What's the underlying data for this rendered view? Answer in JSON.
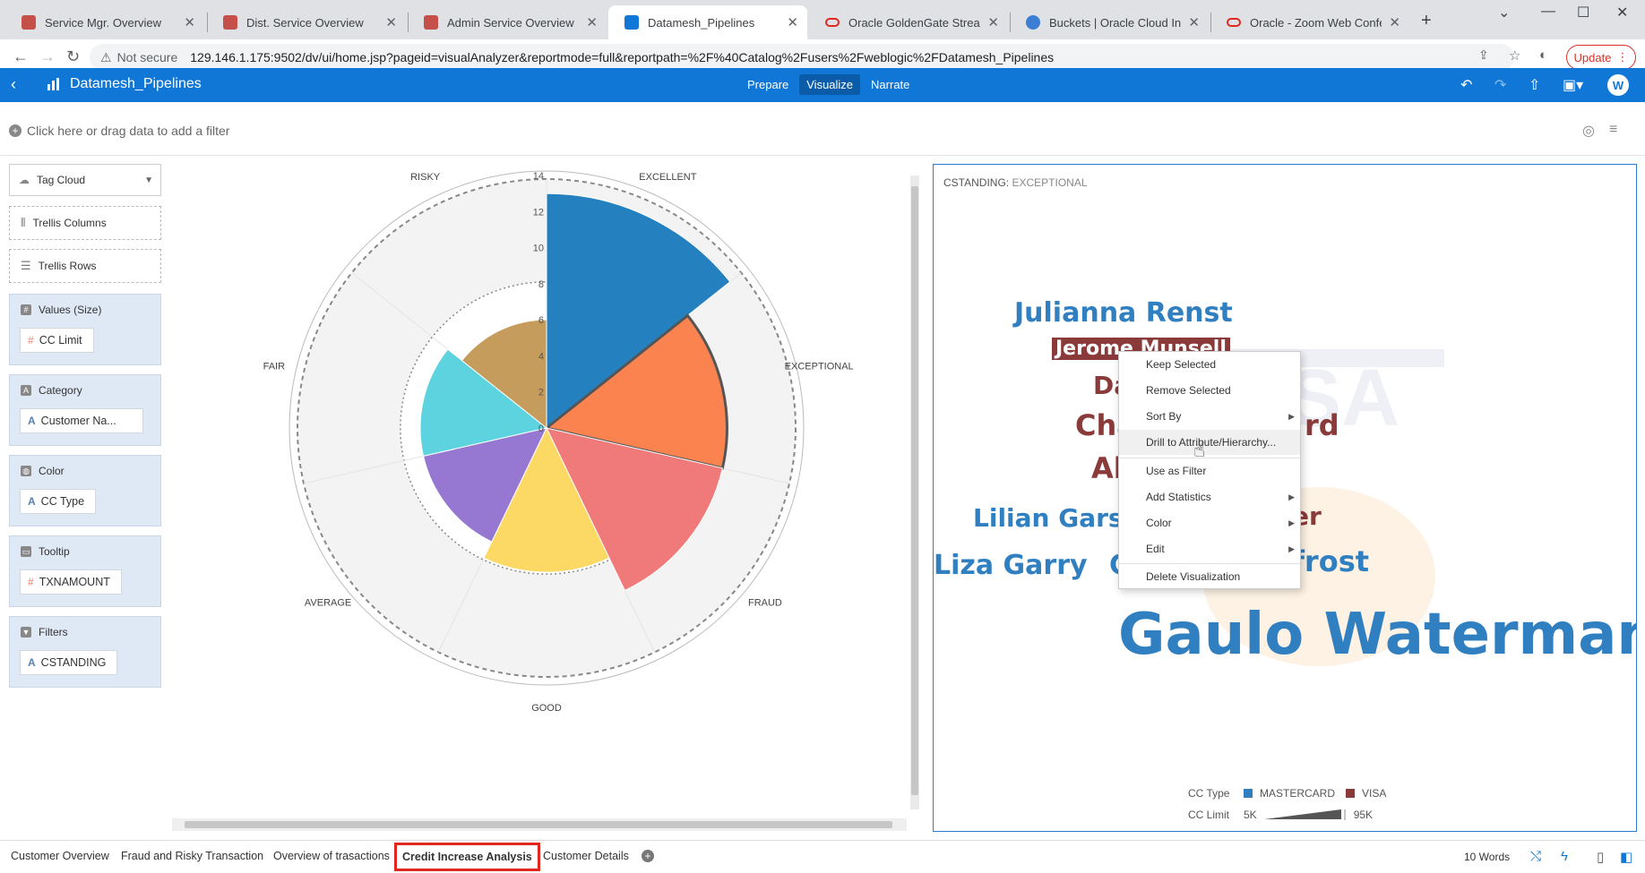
{
  "browser": {
    "tabs": [
      {
        "title": "Service Mgr. Overview",
        "color": "#c5504a"
      },
      {
        "title": "Dist. Service Overview",
        "color": "#c5504a"
      },
      {
        "title": "Admin Service Overview",
        "color": "#c5504a"
      },
      {
        "title": "Datamesh_Pipelines",
        "color": "#1177d6"
      },
      {
        "title": "Oracle GoldenGate Stream Ana",
        "color": "#e0281e"
      },
      {
        "title": "Buckets | Oracle Cloud Infrastru",
        "color": "#3b7ed4"
      },
      {
        "title": "Oracle - Zoom Web Conferenc",
        "color": "#e0281e"
      }
    ],
    "security": "Not secure",
    "url": "129.146.1.175:9502/dv/ui/home.jsp?pageid=visualAnalyzer&reportmode=full&reportpath=%2F%40Catalog%2Fusers%2Fweblogic%2FDatamesh_Pipelines",
    "update_label": "Update"
  },
  "app": {
    "project": "Datamesh_Pipelines",
    "modes": [
      "Prepare",
      "Visualize",
      "Narrate"
    ],
    "active_mode": "Visualize",
    "user_initial": "W"
  },
  "filterbar": {
    "placeholder": "Click here or drag data to add a filter"
  },
  "grammar": {
    "viz_type": "Tag Cloud",
    "trellis_columns": "Trellis Columns",
    "trellis_rows": "Trellis Rows",
    "sections": [
      {
        "header": "Values (Size)",
        "pill": "CC Limit",
        "pill_kind": "hash"
      },
      {
        "header": "Category",
        "pill": "Customer Na...",
        "pill_kind": "alpha"
      },
      {
        "header": "Color",
        "pill": "CC Type",
        "pill_kind": "alpha"
      },
      {
        "header": "Tooltip",
        "pill": "TXNAMOUNT",
        "pill_kind": "hash"
      },
      {
        "header": "Filters",
        "pill": "CSTANDING",
        "pill_kind": "alpha"
      }
    ]
  },
  "chart_data": {
    "type": "polar-area",
    "categories": [
      "EXCELLENT",
      "EXCEPTIONAL",
      "FRAUD",
      "GOOD",
      "AVERAGE",
      "FAIR",
      "RISKY"
    ],
    "values": [
      13,
      10,
      10,
      8,
      7,
      7,
      6
    ],
    "colors": [
      "#2580c0",
      "#fb8350",
      "#f07a7a",
      "#fcd964",
      "#9678d2",
      "#5ed3e0",
      "#c69c5c"
    ],
    "selected": "EXCEPTIONAL",
    "radial_ticks": [
      0,
      2,
      4,
      6,
      8,
      10,
      12,
      14
    ],
    "rmax": 14
  },
  "cloud": {
    "title_key": "CSTANDING:",
    "title_value": "EXCEPTIONAL",
    "words": [
      {
        "text": "Julianna Renst",
        "type": "mc"
      },
      {
        "text": "Jerome Munsell",
        "type": "visa",
        "selected": true
      },
      {
        "text": "Da",
        "type": "visa"
      },
      {
        "text": "Cha",
        "type": "visa"
      },
      {
        "text": "rd",
        "type": "visa"
      },
      {
        "text": "Al",
        "type": "visa"
      },
      {
        "text": "Lilian Gars",
        "type": "mc"
      },
      {
        "text": "er",
        "type": "visa"
      },
      {
        "text": "Liza Garry",
        "type": "mc"
      },
      {
        "text": "C",
        "type": "mc"
      },
      {
        "text": "frost",
        "type": "mc"
      },
      {
        "text": "Gaulo Waterman",
        "type": "mc"
      }
    ],
    "legend": {
      "color_label": "CC Type",
      "color_items": [
        {
          "label": "MASTERCARD",
          "color": "#2f7fc1"
        },
        {
          "label": "VISA",
          "color": "#8b3a3a"
        }
      ],
      "size_label": "CC Limit",
      "size_min": "5K",
      "size_max": "95K"
    }
  },
  "context_menu": {
    "items": [
      "Keep Selected",
      "Remove Selected",
      "Sort By",
      "Drill to Attribute/Hierarchy...",
      "Use as Filter",
      "Add Statistics",
      "Color",
      "Edit",
      "Delete Visualization"
    ],
    "hover": "Drill to Attribute/Hierarchy..."
  },
  "bottom": {
    "tabs": [
      "Customer Overview",
      "Fraud and Risky Transaction",
      "Overview of trasactions",
      "Credit Increase Analysis",
      "Customer Details"
    ],
    "active_tab": "Credit Increase Analysis",
    "word_count": "10 Words"
  }
}
